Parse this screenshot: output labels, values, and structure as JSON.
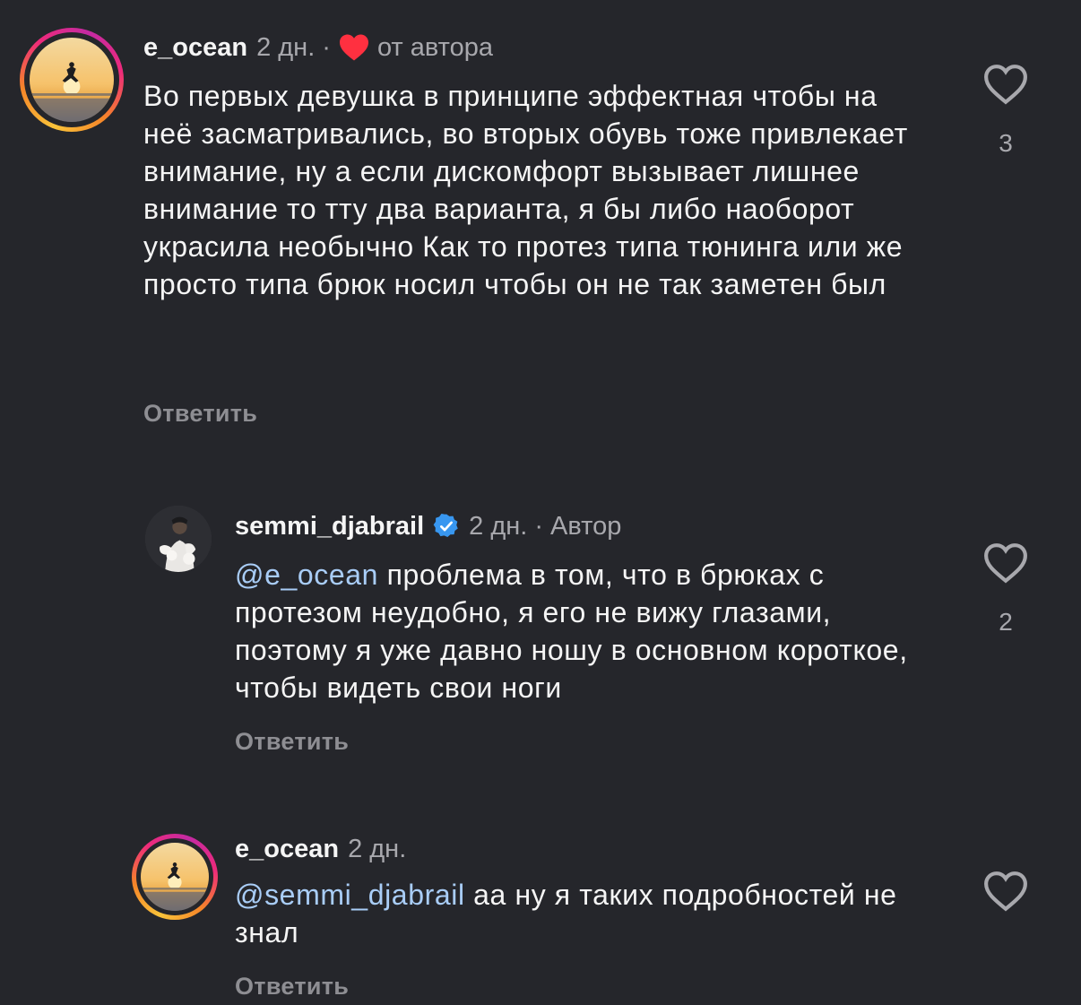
{
  "comments": [
    {
      "username": "e_ocean",
      "time": "2 дн.",
      "separator": "·",
      "author_note": "от автора",
      "author_liked": true,
      "text": "Во первых девушка в принципе эффектная чтобы на неё засматривались, во вторых обувь тоже привлекает внимание, ну а если дискомфорт вызывает лишнее внимание то тту два варианта, я бы либо наоборот украсила необычно Как то протез типа тюнинга или же просто типа брюк носил чтобы он не так заметен был",
      "reply_label": "Ответить",
      "likes": "3",
      "has_story_ring": true
    },
    {
      "username": "semmi_djabrail",
      "verified": true,
      "time": "2 дн.",
      "separator": "·",
      "author_note": "Автор",
      "mention": "@e_ocean",
      "text": " проблема в том, что в брюках с протезом неудобно, я его не вижу глазами, поэтому я уже давно ношу в основном короткое, чтобы видеть свои ноги",
      "reply_label": "Ответить",
      "likes": "2",
      "has_story_ring": false
    },
    {
      "username": "e_ocean",
      "time": "2 дн.",
      "mention": "@semmi_djabrail",
      "text": " аа ну я таких подробностей не знал",
      "reply_label": "Ответить",
      "likes": "",
      "has_story_ring": true
    }
  ],
  "icons": {
    "like": "heart-outline-icon",
    "author_like": "heart-filled-icon",
    "verified": "verified-badge-icon"
  },
  "colors": {
    "background": "#25262b",
    "mention": "#a9cdf7",
    "heart": "#ff3040",
    "verified": "#3897f0"
  }
}
